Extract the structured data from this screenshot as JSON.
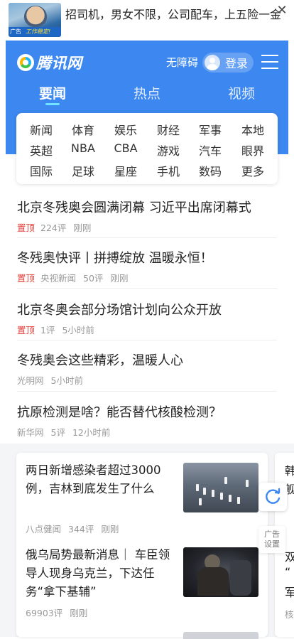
{
  "ad_banner": {
    "text": "招司机，男女不限，公司配车，上五险一金",
    "badge": "广告",
    "thumb_caption": "工作稳定!",
    "close_glyph": "✕"
  },
  "header": {
    "logo_text": "腾讯网",
    "accessibility_label": "无障碍",
    "login_label": "登录",
    "accent_color": "#3c87f0"
  },
  "tabs": [
    {
      "label": "要闻",
      "active": true
    },
    {
      "label": "热点",
      "active": false
    },
    {
      "label": "视频",
      "active": false
    }
  ],
  "channels": [
    [
      "新闻",
      "体育",
      "娱乐",
      "财经",
      "军事",
      "本地"
    ],
    [
      "英超",
      "NBA",
      "CBA",
      "游戏",
      "汽车",
      "眼界"
    ],
    [
      "国际",
      "足球",
      "星座",
      "手机",
      "数码",
      "更多"
    ]
  ],
  "headlines": [
    {
      "title": "北京冬残奥会圆满闭幕 习近平出席闭幕式",
      "pin": "置顶",
      "source": "",
      "comments": "224评",
      "time": "刚刚"
    },
    {
      "title": "冬残奥快评丨拼搏绽放 温暖永恒！",
      "pin": "置顶",
      "source": "央视新闻",
      "comments": "50评",
      "time": "刚刚"
    },
    {
      "title": "北京冬奥会部分场馆计划向公众开放",
      "pin": "置顶",
      "source": "",
      "comments": "1评",
      "time": "5小时前"
    },
    {
      "title": "冬残奥会这些精彩，温暖人心",
      "pin": "",
      "source": "光明网",
      "comments": "",
      "time": "5小时前"
    },
    {
      "title": "抗原检测是啥？能否替代核酸检测？",
      "pin": "",
      "source": "新华网",
      "comments": "5评",
      "time": "12小时前"
    }
  ],
  "feed": [
    {
      "title": "两日新增感染者超过3000例，吉林到底发生了什么",
      "source": "八点健闻",
      "comments": "344评",
      "time": "刚刚"
    },
    {
      "title": "俄乌局势最新消息｜ 车臣领导人现身乌克兰，下达任务“拿下基辅”",
      "source": "",
      "comments": "69903评",
      "time": "刚刚"
    }
  ],
  "next_card_chars": [
    "韩",
    "舰",
    "双",
    "“",
    "军",
    "核"
  ],
  "side_buttons": {
    "refresh_icon": "refresh-icon",
    "ad_setting_label_1": "广告",
    "ad_setting_label_2": "设置"
  }
}
